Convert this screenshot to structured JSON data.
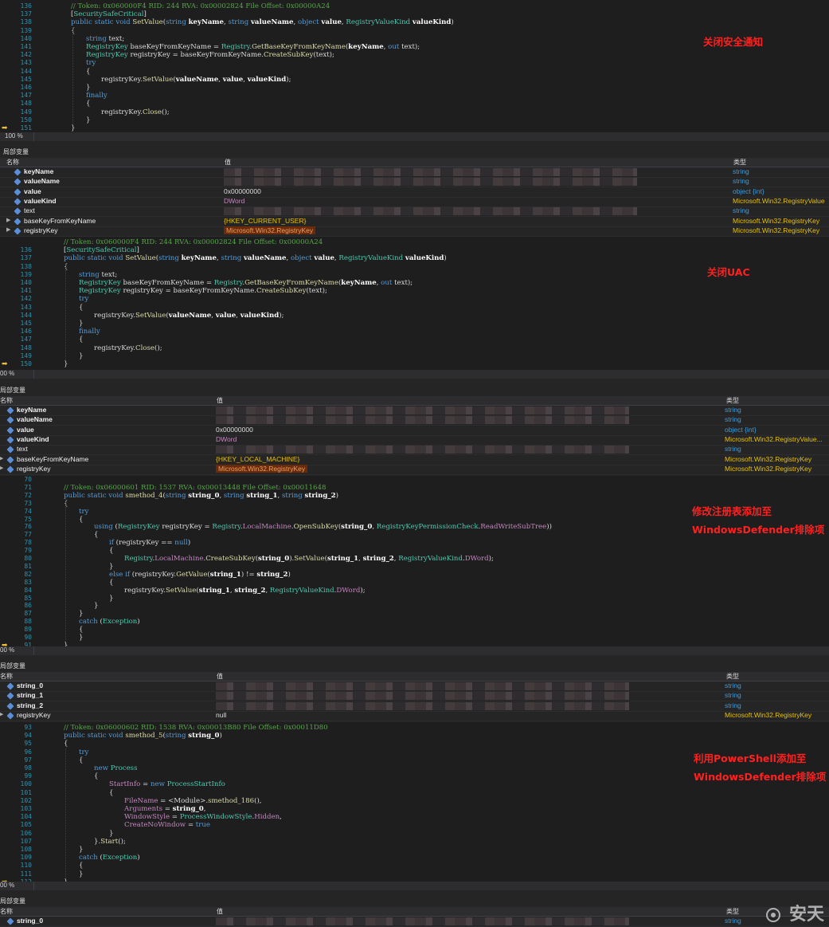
{
  "annotations": {
    "a1": "关闭安全通知",
    "a2": "关闭UAC",
    "a3_l1": "修改注册表添加至",
    "a3_l2": "WindowsDefender排除项",
    "a4_l1": "利用PowerShell添加至",
    "a4_l2": "WindowsDefender排除项"
  },
  "zoom": "100 %",
  "zoom_cut": "00 %",
  "locals_title": "局部变量",
  "locals_title_cut": "局部变量",
  "headers": {
    "name": "名称",
    "value": "值",
    "type": "类型"
  },
  "p1": {
    "lines": [
      {
        "n": "136",
        "text": "// Token: 0x060000F4 RID: 244 RVA: 0x00002824 File Offset: 0x00000A24"
      },
      {
        "n": "137",
        "text": "[SecuritySafeCritical]"
      },
      {
        "n": "138",
        "text": "public static void SetValue(string keyName, string valueName, object value, RegistryValueKind valueKind)"
      },
      {
        "n": "139",
        "text": "{"
      },
      {
        "n": "140",
        "text": "string text;"
      },
      {
        "n": "141",
        "text": "RegistryKey baseKeyFromKeyName = Registry.GetBaseKeyFromKeyName(keyName, out text);"
      },
      {
        "n": "142",
        "text": "RegistryKey registryKey = baseKeyFromKeyName.CreateSubKey(text);"
      },
      {
        "n": "143",
        "text": "try"
      },
      {
        "n": "144",
        "text": "{"
      },
      {
        "n": "145",
        "text": "registryKey.SetValue(valueName, value, valueKind);"
      },
      {
        "n": "146",
        "text": "}"
      },
      {
        "n": "147",
        "text": "finally"
      },
      {
        "n": "148",
        "text": "{"
      },
      {
        "n": "149",
        "text": "registryKey.Close();"
      },
      {
        "n": "150",
        "text": "}"
      },
      {
        "n": "151",
        "text": "}"
      }
    ],
    "rows": [
      {
        "name": "keyName",
        "value": "",
        "type": "string"
      },
      {
        "name": "valueName",
        "value": "",
        "type": "string"
      },
      {
        "name": "value",
        "value": "0x00000000",
        "type": "object {int}"
      },
      {
        "name": "valueKind",
        "value": "DWord",
        "type": "Microsoft.Win32.RegistryValue"
      },
      {
        "name": "text",
        "value": "",
        "type": "string"
      },
      {
        "name": "baseKeyFromKeyName",
        "value": "{HKEY_CURRENT_USER}",
        "type": "Microsoft.Win32.RegistryKey"
      },
      {
        "name": "registryKey",
        "value": "Microsoft.Win32.RegistryKey",
        "type": "Microsoft.Win32.RegistryKey"
      }
    ]
  },
  "p2": {
    "lines": [
      {
        "n": "",
        "text": "// Token: 0x060000F4 RID: 244 RVA: 0x00002824 File Offset: 0x00000A24"
      },
      {
        "n": "136",
        "text": "[SecuritySafeCritical]"
      },
      {
        "n": "137",
        "text": "public static void SetValue(string keyName, string valueName, object value, RegistryValueKind valueKind)"
      },
      {
        "n": "138",
        "text": "{"
      },
      {
        "n": "139",
        "text": "string text;"
      },
      {
        "n": "140",
        "text": "RegistryKey baseKeyFromKeyName = Registry.GetBaseKeyFromKeyName(keyName, out text);"
      },
      {
        "n": "141",
        "text": "RegistryKey registryKey = baseKeyFromKeyName.CreateSubKey(text);"
      },
      {
        "n": "142",
        "text": "try"
      },
      {
        "n": "143",
        "text": "{"
      },
      {
        "n": "144",
        "text": "registryKey.SetValue(valueName, value, valueKind);"
      },
      {
        "n": "145",
        "text": "}"
      },
      {
        "n": "146",
        "text": "finally"
      },
      {
        "n": "147",
        "text": "{"
      },
      {
        "n": "148",
        "text": "registryKey.Close();"
      },
      {
        "n": "149",
        "text": "}"
      },
      {
        "n": "150",
        "text": "}"
      }
    ],
    "rows": [
      {
        "name": "keyName",
        "value": "",
        "type": "string"
      },
      {
        "name": "valueName",
        "value": "",
        "type": "string"
      },
      {
        "name": "value",
        "value": "0x00000000",
        "type": "object {int}"
      },
      {
        "name": "valueKind",
        "value": "DWord",
        "type": "Microsoft.Win32.RegistryValue..."
      },
      {
        "name": "text",
        "value": "",
        "type": "string"
      },
      {
        "name": "baseKeyFromKeyName",
        "value": "{HKEY_LOCAL_MACHINE}",
        "type": "Microsoft.Win32.RegistryKey"
      },
      {
        "name": "registryKey",
        "value": "Microsoft.Win32.RegistryKey",
        "type": "Microsoft.Win32.RegistryKey"
      }
    ]
  },
  "p3": {
    "lines": [
      {
        "n": "70",
        "text": ""
      },
      {
        "n": "71",
        "text": "// Token: 0x06000601 RID: 1537 RVA: 0x00013448 File Offset: 0x00011648"
      },
      {
        "n": "72",
        "text": "public static void smethod_4(string string_0, string string_1, string string_2)"
      },
      {
        "n": "73",
        "text": "{"
      },
      {
        "n": "74",
        "text": "try"
      },
      {
        "n": "75",
        "text": "{"
      },
      {
        "n": "76",
        "text": "using (RegistryKey registryKey = Registry.LocalMachine.OpenSubKey(string_0, RegistryKeyPermissionCheck.ReadWriteSubTree))"
      },
      {
        "n": "77",
        "text": "{"
      },
      {
        "n": "78",
        "text": "if (registryKey == null)"
      },
      {
        "n": "79",
        "text": "{"
      },
      {
        "n": "80",
        "text": "Registry.LocalMachine.CreateSubKey(string_0).SetValue(string_1, string_2, RegistryValueKind.DWord);"
      },
      {
        "n": "81",
        "text": "}"
      },
      {
        "n": "82",
        "text": "else if (registryKey.GetValue(string_1) != string_2)"
      },
      {
        "n": "83",
        "text": "{"
      },
      {
        "n": "84",
        "text": "registryKey.SetValue(string_1, string_2, RegistryValueKind.DWord);"
      },
      {
        "n": "85",
        "text": "}"
      },
      {
        "n": "86",
        "text": "}"
      },
      {
        "n": "87",
        "text": "}"
      },
      {
        "n": "88",
        "text": "catch (Exception)"
      },
      {
        "n": "89",
        "text": "{"
      },
      {
        "n": "90",
        "text": "}"
      },
      {
        "n": "91",
        "text": "}"
      }
    ],
    "rows": [
      {
        "name": "string_0",
        "value": "",
        "type": "string"
      },
      {
        "name": "string_1",
        "value": "",
        "type": "string"
      },
      {
        "name": "string_2",
        "value": "",
        "type": "string"
      },
      {
        "name": "registryKey",
        "value": "null",
        "type": "Microsoft.Win32.RegistryKey"
      }
    ]
  },
  "p4": {
    "lines": [
      {
        "n": "93",
        "text": "// Token: 0x06000602 RID: 1538 RVA: 0x00013B80 File Offset: 0x00011D80"
      },
      {
        "n": "94",
        "text": "public static void smethod_5(string string_0)"
      },
      {
        "n": "95",
        "text": "{"
      },
      {
        "n": "96",
        "text": "try"
      },
      {
        "n": "97",
        "text": "{"
      },
      {
        "n": "98",
        "text": "new Process"
      },
      {
        "n": "99",
        "text": "{"
      },
      {
        "n": "100",
        "text": "StartInfo = new ProcessStartInfo"
      },
      {
        "n": "101",
        "text": "{"
      },
      {
        "n": "102",
        "text": "FileName = <Module>.smethod_186(),"
      },
      {
        "n": "103",
        "text": "Arguments = string_0,"
      },
      {
        "n": "104",
        "text": "WindowStyle = ProcessWindowStyle.Hidden,"
      },
      {
        "n": "105",
        "text": "CreateNoWindow = true"
      },
      {
        "n": "106",
        "text": "}"
      },
      {
        "n": "107",
        "text": "}.Start();"
      },
      {
        "n": "108",
        "text": "}"
      },
      {
        "n": "109",
        "text": "catch (Exception)"
      },
      {
        "n": "110",
        "text": "{"
      },
      {
        "n": "111",
        "text": "}"
      },
      {
        "n": "112",
        "text": "}"
      }
    ],
    "rows": [
      {
        "name": "string_0",
        "value": "",
        "type": "string"
      }
    ]
  },
  "watermark": "安天"
}
